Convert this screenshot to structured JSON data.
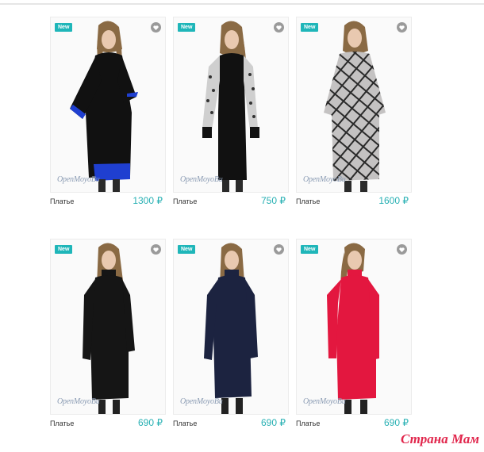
{
  "products": [
    {
      "badge": "New",
      "brand": "OpenMoyoBu",
      "name": "Платье",
      "price": "1300 ₽",
      "dress_color": "#111111",
      "accent": "#1f3fd0",
      "style": "black-blue"
    },
    {
      "badge": "New",
      "brand": "OpenMoyoBu",
      "name": "Платье",
      "price": "750 ₽",
      "dress_color": "#111111",
      "accent": "#cfcfcf",
      "style": "leopard-sleeves"
    },
    {
      "badge": "New",
      "brand": "OpenMoyoBu",
      "name": "Платье",
      "price": "1600 ₽",
      "dress_color": "#bdbcbc",
      "accent": "#2a2a2a",
      "style": "plaid"
    },
    {
      "badge": "New",
      "brand": "OpenMoyoBu",
      "name": "Платье",
      "price": "690 ₽",
      "dress_color": "#151515",
      "accent": "#151515",
      "style": "black"
    },
    {
      "badge": "New",
      "brand": "OpenMoyoBu",
      "name": "Платье",
      "price": "690 ₽",
      "dress_color": "#1c2340",
      "accent": "#1c2340",
      "style": "navy"
    },
    {
      "badge": "New",
      "brand": "OpenMoyoBu",
      "name": "Платье",
      "price": "690 ₽",
      "dress_color": "#e3173f",
      "accent": "#e3173f",
      "style": "red"
    }
  ],
  "icons": {
    "favorite": "heart-icon"
  },
  "watermark": "Страна Мам"
}
